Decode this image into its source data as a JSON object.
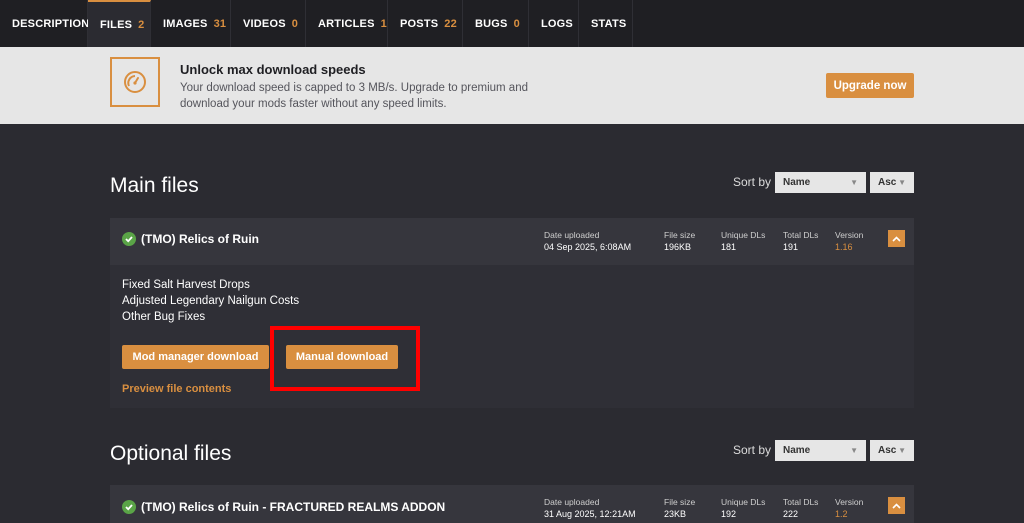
{
  "tabs": [
    {
      "label": "DESCRIPTION",
      "count": ""
    },
    {
      "label": "FILES",
      "count": "2"
    },
    {
      "label": "IMAGES",
      "count": "31"
    },
    {
      "label": "VIDEOS",
      "count": "0"
    },
    {
      "label": "ARTICLES",
      "count": "1"
    },
    {
      "label": "POSTS",
      "count": "22"
    },
    {
      "label": "BUGS",
      "count": "0"
    },
    {
      "label": "LOGS",
      "count": ""
    },
    {
      "label": "STATS",
      "count": ""
    }
  ],
  "banner": {
    "title": "Unlock max download speeds",
    "text": "Your download speed is capped to 3 MB/s. Upgrade to premium and download your mods faster without any speed limits.",
    "button": "Upgrade now",
    "icon": "speedometer-icon"
  },
  "main_files": {
    "heading": "Main files",
    "sort_label": "Sort by",
    "sort_field": "Name",
    "sort_order": "Asc",
    "file": {
      "name": "(TMO) Relics of Ruin",
      "date_label": "Date uploaded",
      "date": "04 Sep 2025, 6:08AM",
      "size_label": "File size",
      "size": "196KB",
      "unique_label": "Unique DLs",
      "unique": "181",
      "total_label": "Total DLs",
      "total": "191",
      "version_label": "Version",
      "version": "1.16",
      "changes": [
        "Fixed Salt Harvest Drops",
        "Adjusted Legendary Nailgun Costs",
        "Other Bug Fixes"
      ],
      "mod_manager_btn": "Mod manager download",
      "manual_btn": "Manual download",
      "preview": "Preview file contents"
    }
  },
  "optional_files": {
    "heading": "Optional files",
    "sort_label": "Sort by",
    "sort_field": "Name",
    "sort_order": "Asc",
    "file": {
      "name": "(TMO) Relics of Ruin - FRACTURED REALMS ADDON",
      "date_label": "Date uploaded",
      "date": "31 Aug 2025, 12:21AM",
      "size_label": "File size",
      "size": "23KB",
      "unique_label": "Unique DLs",
      "unique": "192",
      "total_label": "Total DLs",
      "total": "222",
      "version_label": "Version",
      "version": "1.2"
    }
  },
  "colors": {
    "accent": "#d98f40",
    "check": "#5aa447",
    "highlight": "#ff0000"
  }
}
